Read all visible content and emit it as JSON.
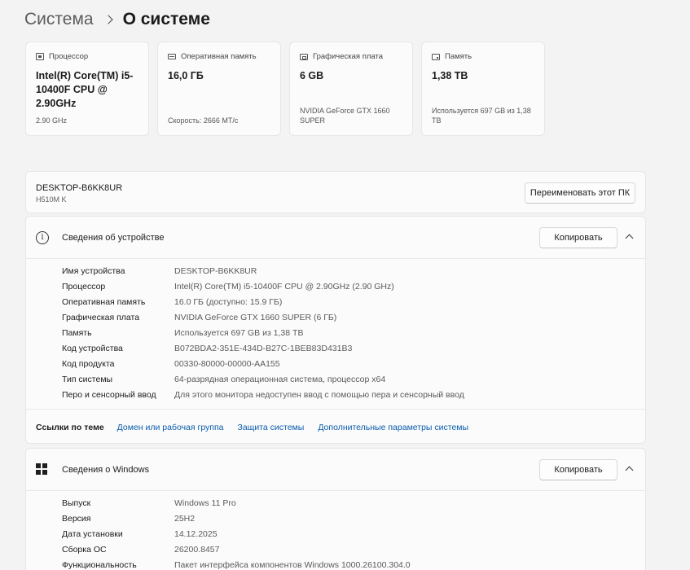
{
  "breadcrumb": {
    "parent": "Система",
    "current": "О системе"
  },
  "cards": [
    {
      "icon": "cpu-icon",
      "label": "Процессор",
      "value": "Intel(R) Core(TM) i5-10400F CPU @ 2.90GHz",
      "sub": "2.90 GHz"
    },
    {
      "icon": "ram-icon",
      "label": "Оперативная память",
      "value": "16,0 ГБ",
      "sub": "Скорость: 2666 МТ/с"
    },
    {
      "icon": "gpu-icon",
      "label": "Графическая плата",
      "value": "6 GB",
      "sub": "NVIDIA GeForce GTX 1660 SUPER"
    },
    {
      "icon": "storage-icon",
      "label": "Память",
      "value": "1,38 ТВ",
      "sub": "Используется 697 GB из 1,38 ТВ"
    }
  ],
  "device": {
    "name": "DESKTOP-B6KK8UR",
    "model": "H510M K",
    "rename_label": "Переименовать этот ПК"
  },
  "device_specs": {
    "title": "Сведения об устройстве",
    "copy_label": "Копировать",
    "rows": [
      {
        "key": "Имя устройства",
        "value": "DESKTOP-B6KK8UR"
      },
      {
        "key": "Процессор",
        "value": "Intel(R) Core(TM) i5-10400F CPU @ 2.90GHz (2.90 GHz)"
      },
      {
        "key": "Оперативная память",
        "value": "16.0 ГБ (доступно: 15.9 ГБ)"
      },
      {
        "key": "Графическая плата",
        "value": "NVIDIA GeForce GTX 1660 SUPER (6 ГБ)"
      },
      {
        "key": "Память",
        "value": "Используется 697 GB из 1,38 ТВ"
      },
      {
        "key": "Код устройства",
        "value": "B072BDA2-351E-434D-B27C-1BEB83D431B3"
      },
      {
        "key": "Код продукта",
        "value": "00330-80000-00000-AA155"
      },
      {
        "key": "Тип системы",
        "value": "64-разрядная операционная система, процессор x64"
      },
      {
        "key": "Перо и сенсорный ввод",
        "value": "Для этого монитора недоступен ввод с помощью пера и сенсорный ввод"
      }
    ],
    "related_label": "Ссылки по теме",
    "related_links": [
      "Домен или рабочая группа",
      "Защита системы",
      "Дополнительные параметры системы"
    ]
  },
  "windows_specs": {
    "title": "Сведения о Windows",
    "copy_label": "Копировать",
    "rows": [
      {
        "key": "Выпуск",
        "value": "Windows 11 Pro"
      },
      {
        "key": "Версия",
        "value": "25H2"
      },
      {
        "key": "Дата установки",
        "value": "14.12.2025"
      },
      {
        "key": "Сборка ОС",
        "value": "26200.8457"
      },
      {
        "key": "Функциональность",
        "value": "Пакет интерфейса компонентов Windows 1000.26100.304.0"
      }
    ]
  },
  "colors": {
    "link": "#0a5cad",
    "background": "#f3f3f3",
    "card": "#fbfbfb"
  }
}
